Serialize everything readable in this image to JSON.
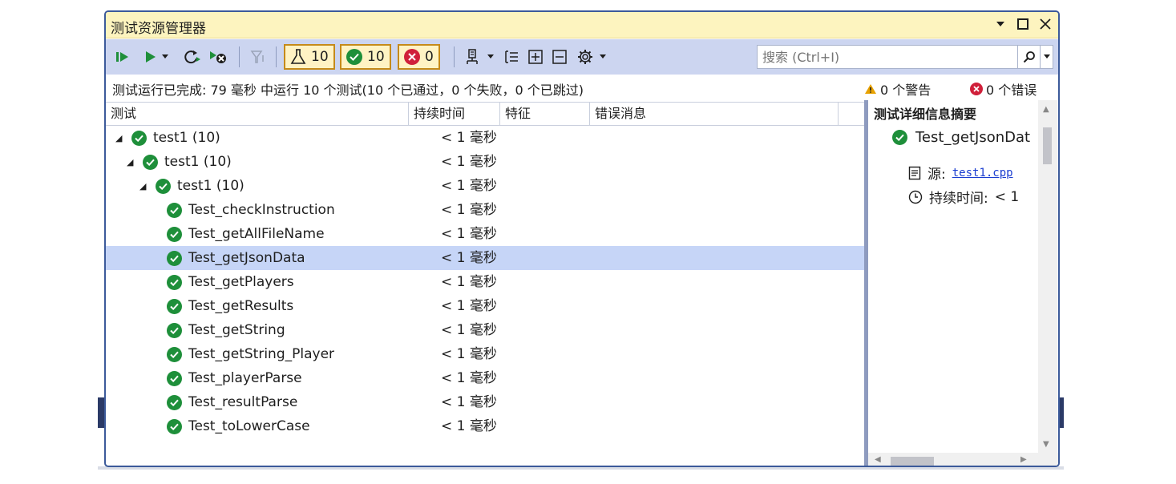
{
  "window": {
    "title": "测试资源管理器"
  },
  "toolbar": {
    "counter_total": "10",
    "counter_passed": "10",
    "counter_failed": "0"
  },
  "search": {
    "placeholder": "搜索 (Ctrl+I)"
  },
  "status": {
    "message": "测试运行已完成: 79 毫秒 中运行 10 个测试(10 个已通过，0 个失败，0 个已跳过)",
    "warnings": "0 个警告",
    "errors": "0 个错误"
  },
  "columns": {
    "test": "测试",
    "duration": "持续时间",
    "traits": "特征",
    "error": "错误消息"
  },
  "tree": [
    {
      "label": "test1 (10)",
      "duration": "< 1 毫秒",
      "level": 0,
      "expanded": true
    },
    {
      "label": "test1 (10)",
      "duration": "< 1 毫秒",
      "level": 1,
      "expanded": true
    },
    {
      "label": "test1 (10)",
      "duration": "< 1 毫秒",
      "level": 2,
      "expanded": true
    },
    {
      "label": "Test_checkInstruction",
      "duration": "< 1 毫秒",
      "level": 3
    },
    {
      "label": "Test_getAllFileName",
      "duration": "< 1 毫秒",
      "level": 3
    },
    {
      "label": "Test_getJsonData",
      "duration": "< 1 毫秒",
      "level": 3,
      "selected": true
    },
    {
      "label": "Test_getPlayers",
      "duration": "< 1 毫秒",
      "level": 3
    },
    {
      "label": "Test_getResults",
      "duration": "< 1 毫秒",
      "level": 3
    },
    {
      "label": "Test_getString",
      "duration": "< 1 毫秒",
      "level": 3
    },
    {
      "label": "Test_getString_Player",
      "duration": "< 1 毫秒",
      "level": 3
    },
    {
      "label": "Test_playerParse",
      "duration": "< 1 毫秒",
      "level": 3
    },
    {
      "label": "Test_resultParse",
      "duration": "< 1 毫秒",
      "level": 3
    },
    {
      "label": "Test_toLowerCase",
      "duration": "< 1 毫秒",
      "level": 3
    }
  ],
  "detail": {
    "title": "测试详细信息摘要",
    "test_name": "Test_getJsonDat",
    "source_label": "源:",
    "source_link": "test1.cpp",
    "duration_label": "持续时间:",
    "duration_value": "< 1"
  },
  "colors": {
    "pass": "#1e8f3a",
    "fail": "#d0203a",
    "warn": "#e8a200",
    "accent": "#3c5a9a",
    "selection": "#c6d5f7",
    "title_bg": "#fdf4bf",
    "toolbar_bg": "#ccd5f0"
  }
}
